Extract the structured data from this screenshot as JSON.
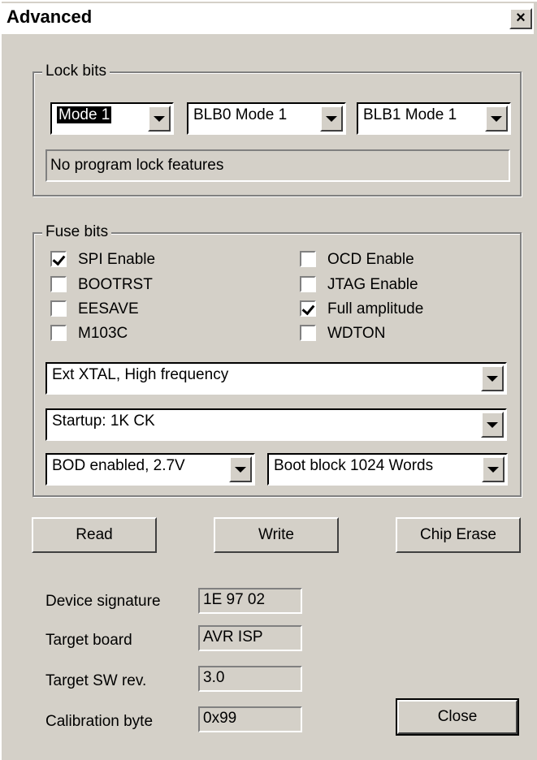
{
  "window": {
    "title": "Advanced",
    "close_glyph": "×"
  },
  "lock_bits": {
    "legend": "Lock bits",
    "mode": "Mode 1",
    "blb0": "BLB0 Mode 1",
    "blb1": "BLB1 Mode 1",
    "description": "No program lock features"
  },
  "fuse_bits": {
    "legend": "Fuse bits",
    "left": [
      {
        "label": "SPI Enable",
        "checked": true
      },
      {
        "label": "BOOTRST",
        "checked": false
      },
      {
        "label": "EESAVE",
        "checked": false
      },
      {
        "label": "M103C",
        "checked": false
      }
    ],
    "right": [
      {
        "label": "OCD Enable",
        "checked": false
      },
      {
        "label": "JTAG Enable",
        "checked": false
      },
      {
        "label": "Full amplitude",
        "checked": true
      },
      {
        "label": "WDTON",
        "checked": false
      }
    ],
    "clock": "Ext XTAL, High frequency",
    "startup": "Startup: 1K CK",
    "bod": "BOD enabled, 2.7V",
    "boot_block": "Boot block 1024 Words"
  },
  "buttons": {
    "read": "Read",
    "write": "Write",
    "chip_erase": "Chip Erase",
    "close": "Close"
  },
  "info": [
    {
      "label": "Device signature",
      "value": "1E 97 02"
    },
    {
      "label": "Target board",
      "value": "AVR ISP"
    },
    {
      "label": "Target SW rev.",
      "value": "3.0"
    },
    {
      "label": "Calibration byte",
      "value": "0x99"
    }
  ]
}
